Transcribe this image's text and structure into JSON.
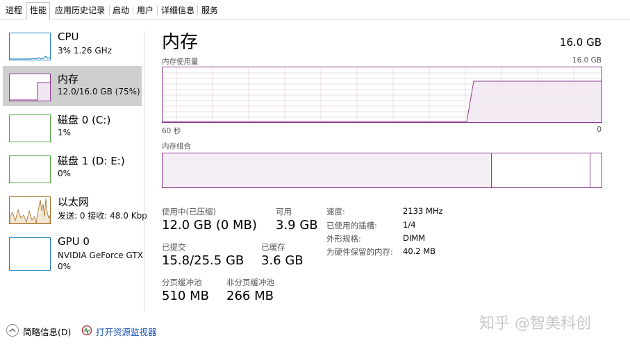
{
  "tabs": [
    "进程",
    "性能",
    "应用历史记录",
    "启动",
    "用户",
    "详细信息",
    "服务"
  ],
  "sidebar": {
    "items": [
      {
        "title": "CPU",
        "sub": "3% 1.26 GHz"
      },
      {
        "title": "内存",
        "sub": "12.0/16.0 GB (75%)"
      },
      {
        "title": "磁盘 0 (C:)",
        "sub": "1%"
      },
      {
        "title": "磁盘 1 (D: E:)",
        "sub": "0%"
      },
      {
        "title": "以太网",
        "sub": "发送: 0 接收: 48.0 Kbp"
      },
      {
        "title": "GPU 0",
        "sub": "NVIDIA GeForce GTX",
        "sub2": "0%"
      }
    ]
  },
  "main": {
    "title": "内存",
    "total": "16.0 GB",
    "usage_label": "内存使用量",
    "usage_max": "16.0 GB",
    "time_left": "60 秒",
    "time_right": "0",
    "composition_label": "内存组合",
    "used_fraction": 0.75,
    "standby_fraction": 0.225
  },
  "stats": {
    "in_use_label": "使用中(已压缩)",
    "in_use_value": "12.0 GB (0 MB)",
    "available_label": "可用",
    "available_value": "3.9 GB",
    "committed_label": "已提交",
    "committed_value": "15.8/25.5 GB",
    "cached_label": "已缓存",
    "cached_value": "3.6 GB",
    "paged_label": "分页缓冲池",
    "paged_value": "510 MB",
    "nonpaged_label": "非分页缓冲池",
    "nonpaged_value": "266 MB"
  },
  "details": [
    {
      "label": "速度:",
      "value": "2133 MHz"
    },
    {
      "label": "已使用的插槽:",
      "value": "1/4"
    },
    {
      "label": "外形规格:",
      "value": "DIMM"
    },
    {
      "label": "为硬件保留的内存:",
      "value": "40.2 MB"
    }
  ],
  "bottom": {
    "brief": "简略信息(D)",
    "monitor": "打开资源监视器"
  },
  "watermark": "知乎 @智美科创",
  "colors": {
    "memory": "#8b3a8f",
    "cpu": "#1f7fc1",
    "disk": "#4ba33b",
    "ethernet": "#a77022",
    "gpu": "#1f7fc1",
    "link": "#1a55b8"
  }
}
